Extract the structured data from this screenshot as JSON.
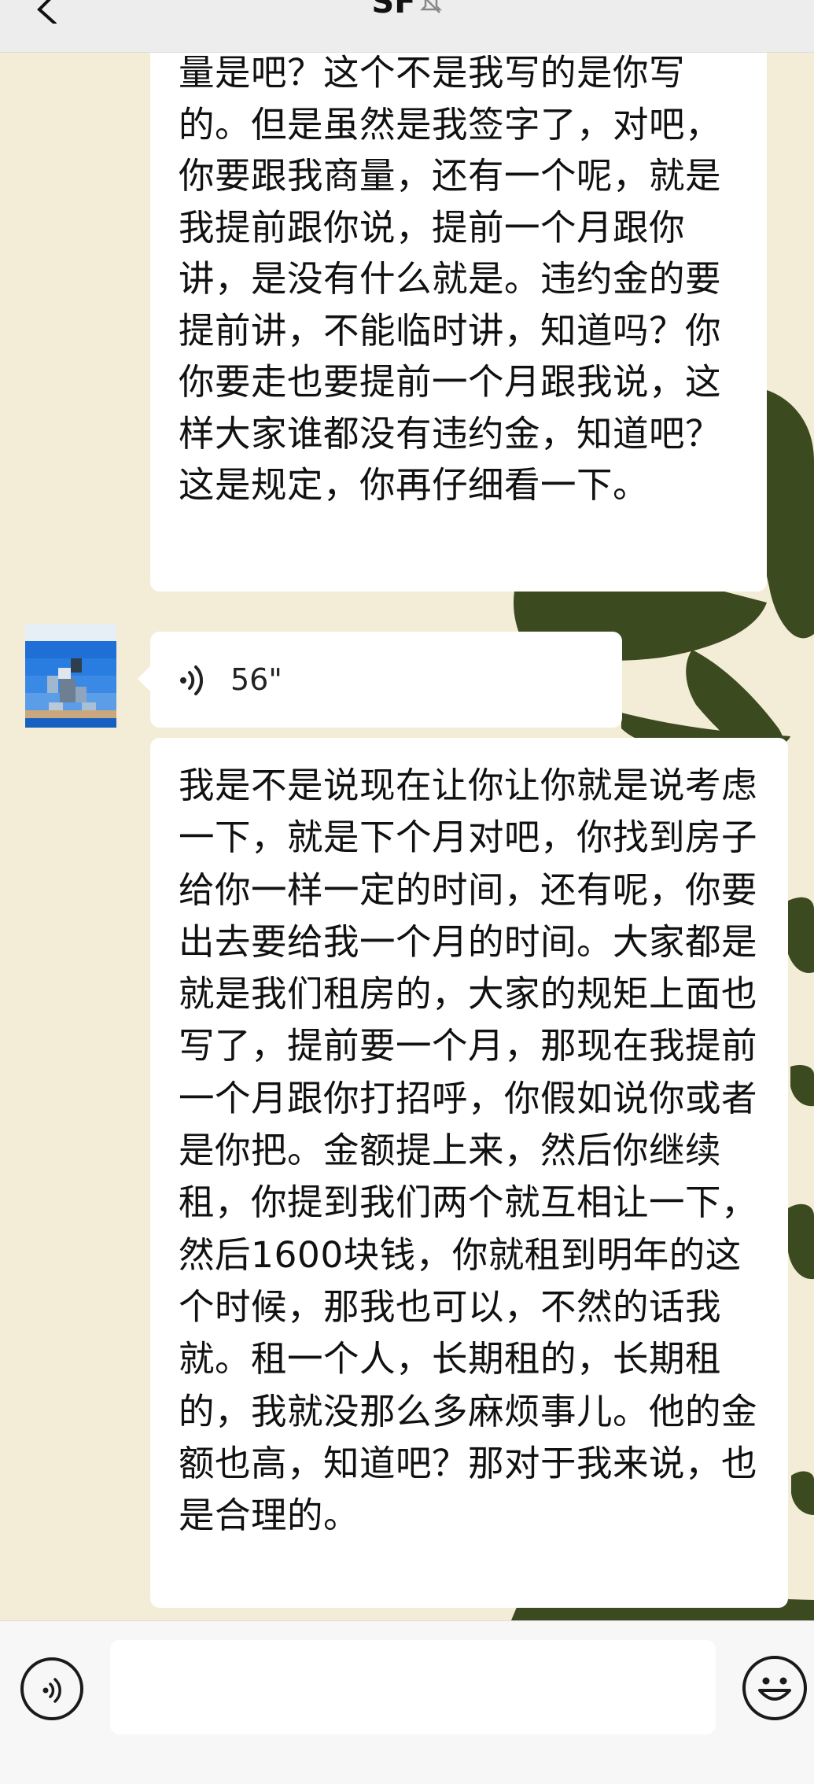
{
  "nav": {
    "title": "SF",
    "back_icon": "chevron-left-icon",
    "muted_icon": "bell-slash-icon"
  },
  "messages": [
    {
      "sender": "contact",
      "type": "text",
      "text": "量是吧？这个不是我写的是你写的。但是虽然是我签字了，对吧，你要跟我商量，还有一个呢，就是我提前跟你说，提前一个月跟你讲，是没有什么就是。违约金的要提前讲，不能临时讲，知道吗？你你要走也要提前一个月跟我说，这样大家谁都没有违约金，知道吧？这是规定，你再仔细看一下。"
    },
    {
      "sender": "contact",
      "type": "voice",
      "duration": "56\"",
      "icon": "voice-wave-icon"
    },
    {
      "sender": "contact",
      "type": "text",
      "text": "我是不是说现在让你让你就是说考虑一下，就是下个月对吧，你找到房子给你一样一定的时间，还有呢，你要出去要给我一个月的时间。大家都是就是我们租房的，大家的规矩上面也写了，提前要一个月，那现在我提前一个月跟你打招呼，你假如说你或者是你把。金额提上来，然后你继续租，你提到我们两个就互相让一下，然后1600块钱，你就租到明年的这个时候，那我也可以，不然的话我就。租一个人，长期租的，长期租的，我就没那么多麻烦事儿。他的金额也高，知道吧？那对于我来说，也是合理的。"
    }
  ],
  "input_bar": {
    "voice_icon": "voice-input-icon",
    "input_value": "",
    "emoji_icon": "emoji-icon"
  },
  "colors": {
    "wallpaper": "#f3ecd6",
    "wallpaper_shape": "#3c4a1f",
    "bubble": "#ffffff",
    "nav_bar": "#ededed",
    "input_bar": "#f7f7f7"
  }
}
